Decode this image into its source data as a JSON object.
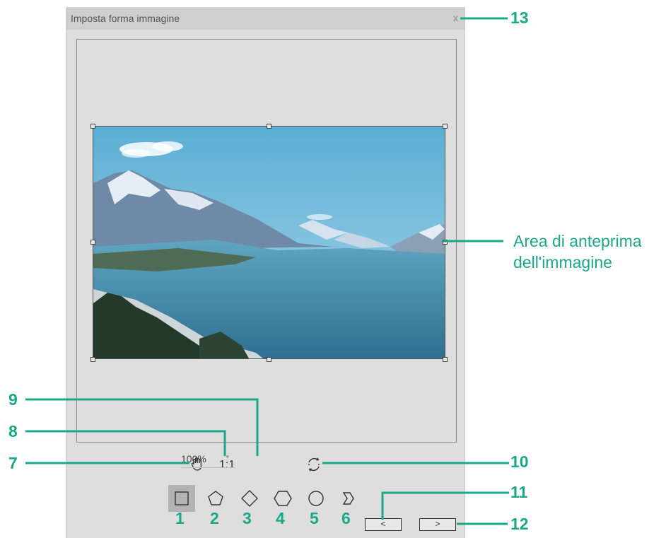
{
  "dialog": {
    "title": "Imposta forma immagine",
    "close_label": "x"
  },
  "preview": {
    "image_alt": "Anteprima immagine: lago tra montagne innevate"
  },
  "toolbar": {
    "fit_label": "1:1",
    "zoom_value": "100%",
    "zoom_arrow": "▾"
  },
  "shapes": [
    {
      "name": "rectangle",
      "number": "1",
      "selected": true
    },
    {
      "name": "pentagon",
      "number": "2",
      "selected": false
    },
    {
      "name": "diamond",
      "number": "3",
      "selected": false
    },
    {
      "name": "hexagon",
      "number": "4",
      "selected": false
    },
    {
      "name": "circle",
      "number": "5",
      "selected": false
    },
    {
      "name": "chevron",
      "number": "6",
      "selected": false
    }
  ],
  "nav": {
    "prev_label": "<",
    "next_label": ">"
  },
  "callouts": {
    "c7": "7",
    "c8": "8",
    "c9": "9",
    "c10": "10",
    "c11": "11",
    "c12": "12",
    "c13": "13",
    "preview_area_line1": "Area di anteprima",
    "preview_area_line2": "dell'immagine"
  },
  "colors": {
    "callout": "#1aa88a",
    "dialog_bg": "#dedede",
    "titlebar_bg": "#cfcfcf",
    "selected_shape_bg": "#b3b3b3"
  }
}
